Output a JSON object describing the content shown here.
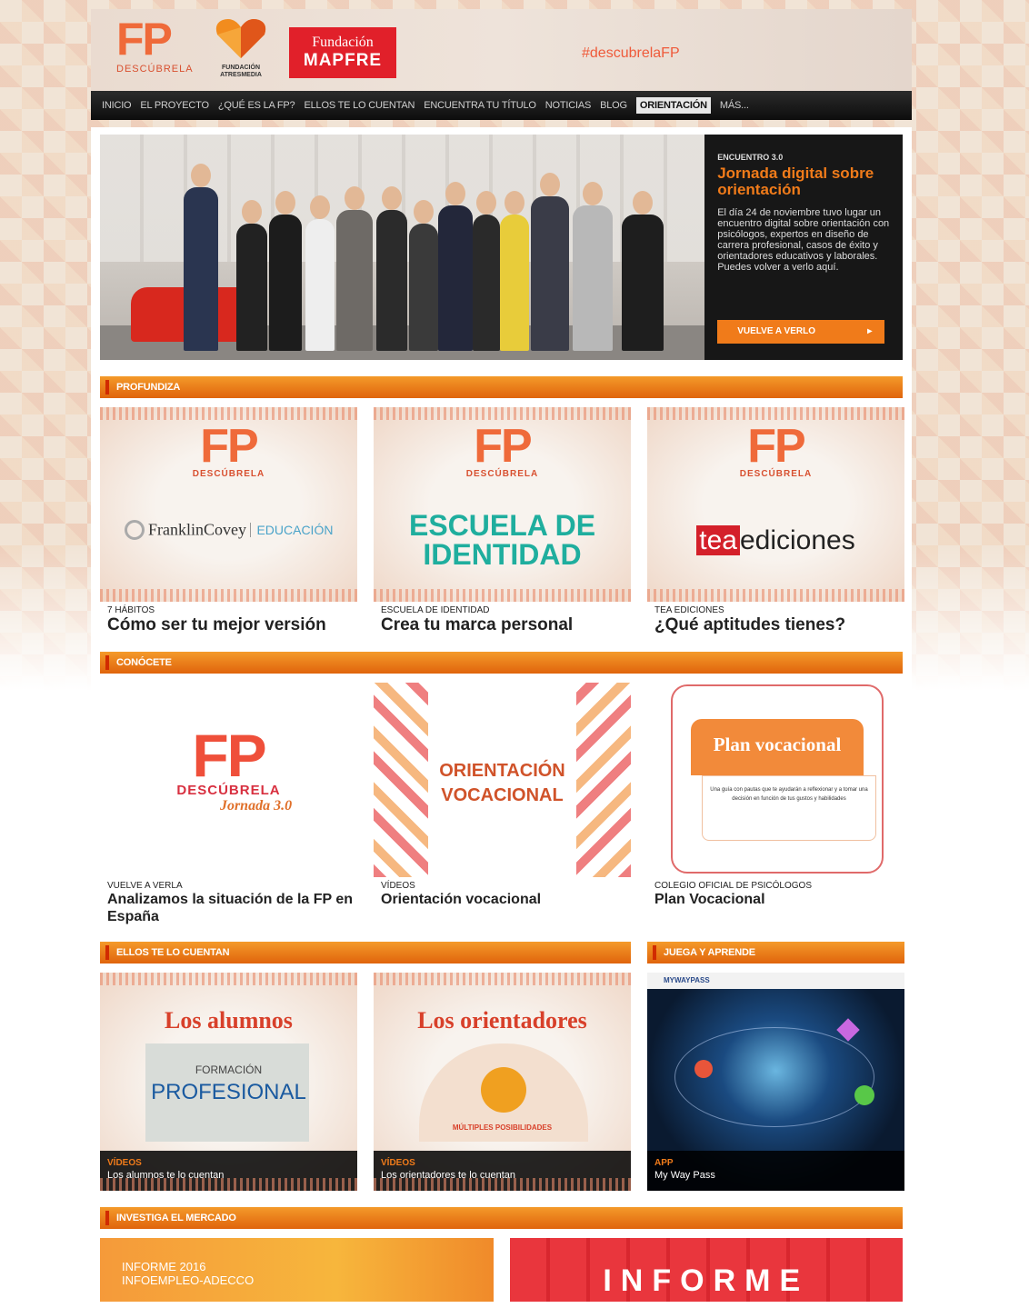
{
  "header": {
    "logo_fp": "FP",
    "logo_fp_sub": "DESCÚBRELA",
    "logo_atresmedia_1": "FUNDACIÓN",
    "logo_atresmedia_2": "ATRESMEDIA",
    "logo_mapfre_1": "Fundación",
    "logo_mapfre_2": "MAPFRE",
    "hashtag": "#descubrelaFP"
  },
  "nav": {
    "items": [
      "INICIO",
      "EL PROYECTO",
      "¿QUÉ ES LA FP?",
      "ELLOS TE LO CUENTAN",
      "ENCUENTRA TU TÍTULO",
      "NOTICIAS",
      "BLOG",
      "ORIENTACIÓN",
      "MÁS..."
    ],
    "active_index": 7
  },
  "hero": {
    "kicker": "ENCUENTRO 3.0",
    "title": "Jornada digital sobre orientación",
    "description": "El día 24 de noviembre tuvo lugar un encuentro digital sobre orientación con psicólogos, expertos en diseño de carrera profesional, casos de éxito y orientadores educativos y laborales. Puedes volver a verlo aquí.",
    "cta": "VUELVE A VERLO"
  },
  "profundiza": {
    "label": "PROFUNDIZA",
    "cards": [
      {
        "kicker": "7 HÁBITOS",
        "title": "Cómo ser tu mejor versión",
        "brand": "FranklinCovey",
        "brand2": "EDUCACIÓN"
      },
      {
        "kicker": "ESCUELA DE IDENTIDAD",
        "title": "Crea tu marca personal",
        "brand": "ESCUELA DE",
        "brand2": "IDENTIDAD"
      },
      {
        "kicker": "TEA EDICIONES",
        "title": "¿Qué aptitudes tienes?",
        "brand": "tea",
        "brand2": "ediciones"
      }
    ]
  },
  "conocete": {
    "label": "CONÓCETE",
    "cards": [
      {
        "kicker": "VUELVE A VERLA",
        "title": "Analizamos la situación de la FP en España",
        "img_1": "FP",
        "img_2": "DESCÚBRELA",
        "img_3": "Jornada 3.0"
      },
      {
        "kicker": "VÍDEOS",
        "title": "Orientación vocacional",
        "img_1": "ORIENTACIÓN",
        "img_2": "VOCACIONAL"
      },
      {
        "kicker": "COLEGIO OFICIAL DE PSICÓLOGOS",
        "title": "Plan Vocacional",
        "img_1": "Plan vocacional",
        "img_2": "Una guía con pautas que te ayudarán a reflexionar y a tomar una decisión en función de tus gustos y habilidades"
      }
    ]
  },
  "ellos": {
    "label": "ELLOS TE LO CUENTAN",
    "cards": [
      {
        "kicker": "VÍDEOS",
        "title": "Los alumnos te lo cuentan",
        "img_1": "Los alumnos",
        "img_2": "FORMACIÓN",
        "img_3": "PROFESIONAL"
      },
      {
        "kicker": "VÍDEOS",
        "title": "Los orientadores te lo cuentan",
        "img_1": "Los orientadores",
        "img_2": "MÚLTIPLES POSIBILIDADES"
      }
    ]
  },
  "juega": {
    "label": "JUEGA Y APRENDE",
    "card": {
      "kicker": "APP",
      "title": "My Way Pass",
      "img_1": "MYWAYPASS"
    }
  },
  "investiga": {
    "label": "INVESTIGA EL MERCADO",
    "banner1_line1": "INFORME 2016",
    "banner1_line2": "INFOEMPLEO-ADECCO",
    "banner2": "INFORME"
  },
  "colors": {
    "accent": "#f07b1a",
    "nav_bg": "#111111",
    "brand_red": "#e1202a"
  }
}
